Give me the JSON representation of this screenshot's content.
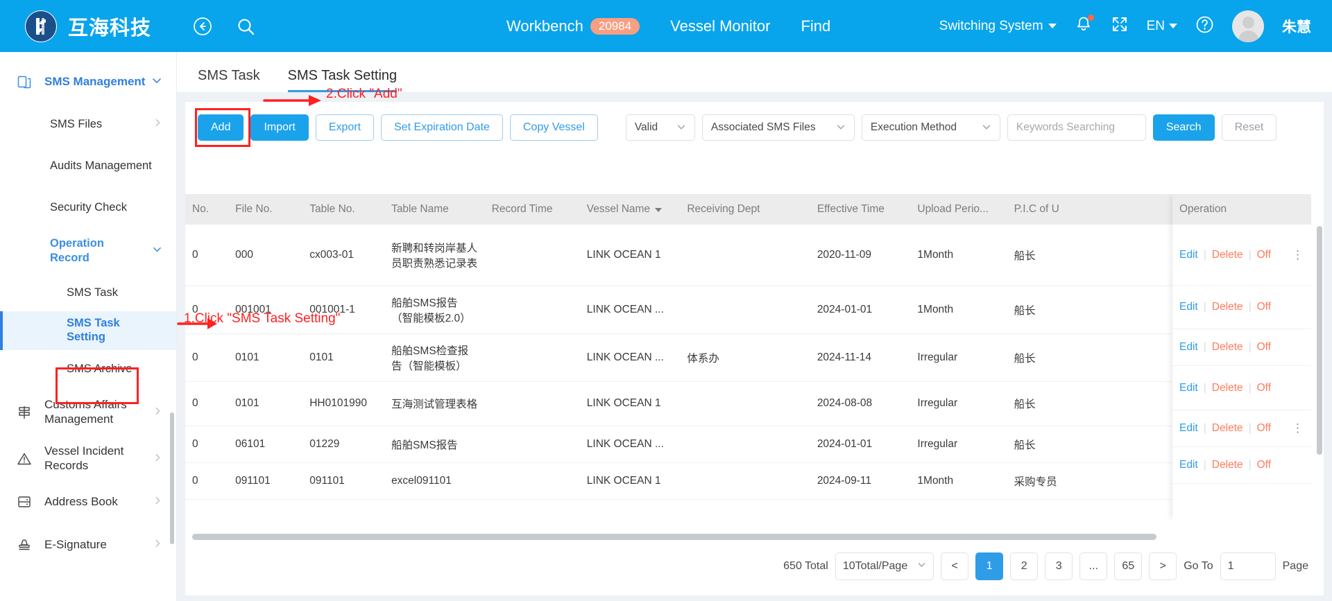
{
  "topbar": {
    "brand_name": "互海科技",
    "back_icon": "back-arrow-icon",
    "search_icon": "search-icon",
    "nav": [
      {
        "label": "Workbench",
        "badge": "20984"
      },
      {
        "label": "Vessel Monitor",
        "badge": ""
      },
      {
        "label": "Find",
        "badge": ""
      }
    ],
    "switch_system": "Switching System",
    "language": "EN",
    "bell_icon": "bell-icon",
    "fullscreen_icon": "fullscreen-icon",
    "help_icon": "help-circle-icon",
    "user_name": "朱慧"
  },
  "sidebar": {
    "groups": [
      {
        "label": "SMS Management",
        "icon": "documents-icon",
        "active": true
      }
    ],
    "sub_items": [
      {
        "label": "SMS Files",
        "chev": true
      },
      {
        "label": "Audits Management",
        "chev": false
      },
      {
        "label": "Security Check",
        "chev": false
      },
      {
        "label": "Operation Record",
        "chev": true,
        "active": true
      }
    ],
    "third_items": [
      {
        "label": "SMS Task",
        "current": false
      },
      {
        "label": "SMS Task Setting",
        "current": true
      },
      {
        "label": "SMS Archive",
        "current": false
      }
    ],
    "bottom_groups": [
      {
        "label": "Customs Affairs Management",
        "icon": "customs-icon"
      },
      {
        "label": "Vessel Incident Records",
        "icon": "warning-triangle-icon"
      },
      {
        "label": "Address Book",
        "icon": "address-book-icon"
      },
      {
        "label": "E-Signature",
        "icon": "stamp-icon"
      }
    ]
  },
  "tabs": [
    {
      "label": "SMS Task",
      "active": false
    },
    {
      "label": "SMS Task Setting",
      "active": true
    }
  ],
  "toolbar": {
    "buttons": [
      {
        "label": "Add",
        "style": "primary"
      },
      {
        "label": "Import",
        "style": "primary"
      },
      {
        "label": "Export",
        "style": "outline"
      },
      {
        "label": "Set Expiration Date",
        "style": "outline"
      },
      {
        "label": "Copy Vessel",
        "style": "outline"
      }
    ],
    "filters": [
      {
        "value": "Valid"
      },
      {
        "value": "Associated SMS Files"
      },
      {
        "value": "Execution Method"
      }
    ],
    "keywords_placeholder": "Keywords Searching",
    "keywords_value": "",
    "search_label": "Search",
    "reset_label": "Reset"
  },
  "annotations": [
    {
      "id": "step1",
      "text": "1.Click \"SMS Task Setting\"",
      "color": "#ff2020"
    },
    {
      "id": "step2",
      "text": "2.Click \"Add\"",
      "color": "#ff2020"
    }
  ],
  "table": {
    "headers": [
      {
        "label": "No.",
        "sort": false
      },
      {
        "label": "File No.",
        "sort": false
      },
      {
        "label": "Table No.",
        "sort": false
      },
      {
        "label": "Table Name",
        "sort": false
      },
      {
        "label": "Record Time",
        "sort": false
      },
      {
        "label": "Vessel Name",
        "sort": true
      },
      {
        "label": "Receiving Dept",
        "sort": false
      },
      {
        "label": "Effective Time",
        "sort": false
      },
      {
        "label": "Upload Perio...",
        "sort": false
      },
      {
        "label": "P.I.C of U",
        "sort": false
      }
    ],
    "operation_header": "Operation",
    "rows": [
      {
        "no": "0",
        "file_no": "000",
        "table_no": "cx003-01",
        "table_name": "新聘和转岗岸基人员职责熟悉记录表",
        "record_time": "",
        "vessel_name": "LINK OCEAN 1",
        "receiving_dept": "",
        "effective_time": "2020-11-09",
        "upload_period": "1Month",
        "pic": "船长"
      },
      {
        "no": "0",
        "file_no": "001001",
        "table_no": "001001-1",
        "table_name": "船舶SMS报告（智能模板2.0）",
        "record_time": "",
        "vessel_name": "LINK OCEAN ...",
        "receiving_dept": "",
        "effective_time": "2024-01-01",
        "upload_period": "1Month",
        "pic": "船长"
      },
      {
        "no": "0",
        "file_no": "0101",
        "table_no": "0101",
        "table_name": "船舶SMS检查报告（智能模板）",
        "record_time": "",
        "vessel_name": "LINK OCEAN ...",
        "receiving_dept": "体系办",
        "effective_time": "2024-11-14",
        "upload_period": "Irregular",
        "pic": "船长"
      },
      {
        "no": "0",
        "file_no": "0101",
        "table_no": "HH0101990",
        "table_name": "互海测试管理表格",
        "record_time": "",
        "vessel_name": "LINK OCEAN 1",
        "receiving_dept": "",
        "effective_time": "2024-08-08",
        "upload_period": "Irregular",
        "pic": "船长"
      },
      {
        "no": "0",
        "file_no": "06101",
        "table_no": "01229",
        "table_name": "船舶SMS报告",
        "record_time": "",
        "vessel_name": "LINK OCEAN ...",
        "receiving_dept": "",
        "effective_time": "2024-01-01",
        "upload_period": "Irregular",
        "pic": "船长"
      },
      {
        "no": "0",
        "file_no": "091101",
        "table_no": "091101",
        "table_name": "excel091101",
        "record_time": "",
        "vessel_name": "LINK OCEAN 1",
        "receiving_dept": "",
        "effective_time": "2024-09-11",
        "upload_period": "1Month",
        "pic": "采购专员"
      }
    ],
    "op_links": {
      "edit": "Edit",
      "delete": "Delete",
      "off": "Off",
      "more": "⋮"
    }
  },
  "pagination": {
    "total_label": "650 Total",
    "page_size": "10Total/Page",
    "prev": "<",
    "next": ">",
    "pages": [
      "1",
      "2",
      "3",
      "...",
      "65"
    ],
    "active_page": "1",
    "goto_label": "Go To",
    "goto_value": "1",
    "page_label": "Page"
  }
}
